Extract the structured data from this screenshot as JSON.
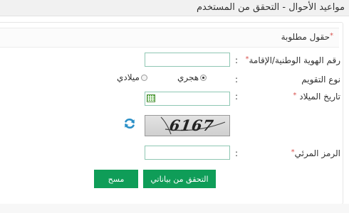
{
  "header": {
    "title": "مواعيد الأحوال - التحقق من المستخدم"
  },
  "form": {
    "required_note": "حقول مطلوبة",
    "required_star": "*",
    "id_label": "رقم الهوية الوطنية/الإقامة",
    "id_value": "",
    "calendar_type_label": "نوع التقويم",
    "calendar_options": {
      "hijri": "هجري",
      "gregorian": "ميلادي",
      "selected": "هجري"
    },
    "birth_date_label": "تاريخ الميلاد",
    "birth_date_value": "",
    "captcha_text": "6167",
    "visual_code_label": "الرمز المرئي",
    "visual_code_value": "",
    "colon": ":"
  },
  "buttons": {
    "verify_label": "التحقق من بياناتي",
    "clear_label": "مسح"
  },
  "colors": {
    "primary_button": "#0f9d58",
    "field_border": "#8fc7b3",
    "required_star": "#d9534f",
    "refresh_icon": "#2a8fc7",
    "calendar_icon": "#6fb85a"
  },
  "icons": [
    "refresh-icon",
    "calendar-icon"
  ]
}
